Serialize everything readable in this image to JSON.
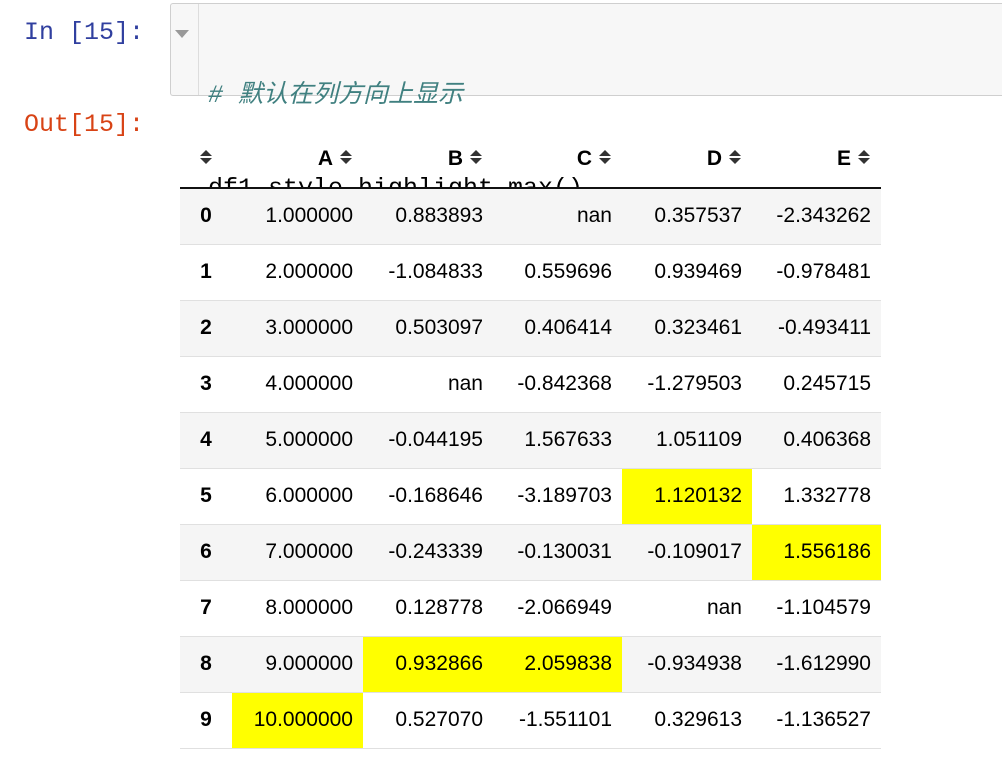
{
  "input_cell": {
    "prompt": "In [15]:",
    "comment": "# 默认在列方向上显示",
    "code": "df1.style.highlight_max()"
  },
  "output_cell": {
    "prompt": "Out[15]:"
  },
  "table": {
    "sort_icon": "sort-icon",
    "highlight_color": "#ffff00",
    "columns": [
      "A",
      "B",
      "C",
      "D",
      "E"
    ],
    "rows": [
      {
        "index": "0",
        "cells": [
          {
            "value": "1.000000",
            "highlight": false
          },
          {
            "value": "0.883893",
            "highlight": false
          },
          {
            "value": "nan",
            "highlight": false
          },
          {
            "value": "0.357537",
            "highlight": false
          },
          {
            "value": "-2.343262",
            "highlight": false
          }
        ]
      },
      {
        "index": "1",
        "cells": [
          {
            "value": "2.000000",
            "highlight": false
          },
          {
            "value": "-1.084833",
            "highlight": false
          },
          {
            "value": "0.559696",
            "highlight": false
          },
          {
            "value": "0.939469",
            "highlight": false
          },
          {
            "value": "-0.978481",
            "highlight": false
          }
        ]
      },
      {
        "index": "2",
        "cells": [
          {
            "value": "3.000000",
            "highlight": false
          },
          {
            "value": "0.503097",
            "highlight": false
          },
          {
            "value": "0.406414",
            "highlight": false
          },
          {
            "value": "0.323461",
            "highlight": false
          },
          {
            "value": "-0.493411",
            "highlight": false
          }
        ]
      },
      {
        "index": "3",
        "cells": [
          {
            "value": "4.000000",
            "highlight": false
          },
          {
            "value": "nan",
            "highlight": false
          },
          {
            "value": "-0.842368",
            "highlight": false
          },
          {
            "value": "-1.279503",
            "highlight": false
          },
          {
            "value": "0.245715",
            "highlight": false
          }
        ]
      },
      {
        "index": "4",
        "cells": [
          {
            "value": "5.000000",
            "highlight": false
          },
          {
            "value": "-0.044195",
            "highlight": false
          },
          {
            "value": "1.567633",
            "highlight": false
          },
          {
            "value": "1.051109",
            "highlight": false
          },
          {
            "value": "0.406368",
            "highlight": false
          }
        ]
      },
      {
        "index": "5",
        "cells": [
          {
            "value": "6.000000",
            "highlight": false
          },
          {
            "value": "-0.168646",
            "highlight": false
          },
          {
            "value": "-3.189703",
            "highlight": false
          },
          {
            "value": "1.120132",
            "highlight": true
          },
          {
            "value": "1.332778",
            "highlight": false
          }
        ]
      },
      {
        "index": "6",
        "cells": [
          {
            "value": "7.000000",
            "highlight": false
          },
          {
            "value": "-0.243339",
            "highlight": false
          },
          {
            "value": "-0.130031",
            "highlight": false
          },
          {
            "value": "-0.109017",
            "highlight": false
          },
          {
            "value": "1.556186",
            "highlight": true
          }
        ]
      },
      {
        "index": "7",
        "cells": [
          {
            "value": "8.000000",
            "highlight": false
          },
          {
            "value": "0.128778",
            "highlight": false
          },
          {
            "value": "-2.066949",
            "highlight": false
          },
          {
            "value": "nan",
            "highlight": false
          },
          {
            "value": "-1.104579",
            "highlight": false
          }
        ]
      },
      {
        "index": "8",
        "cells": [
          {
            "value": "9.000000",
            "highlight": false
          },
          {
            "value": "0.932866",
            "highlight": true
          },
          {
            "value": "2.059838",
            "highlight": true
          },
          {
            "value": "-0.934938",
            "highlight": false
          },
          {
            "value": "-1.612990",
            "highlight": false
          }
        ]
      },
      {
        "index": "9",
        "cells": [
          {
            "value": "10.000000",
            "highlight": true
          },
          {
            "value": "0.527070",
            "highlight": false
          },
          {
            "value": "-1.551101",
            "highlight": false
          },
          {
            "value": "0.329613",
            "highlight": false
          },
          {
            "value": "-1.136527",
            "highlight": false
          }
        ]
      }
    ]
  }
}
